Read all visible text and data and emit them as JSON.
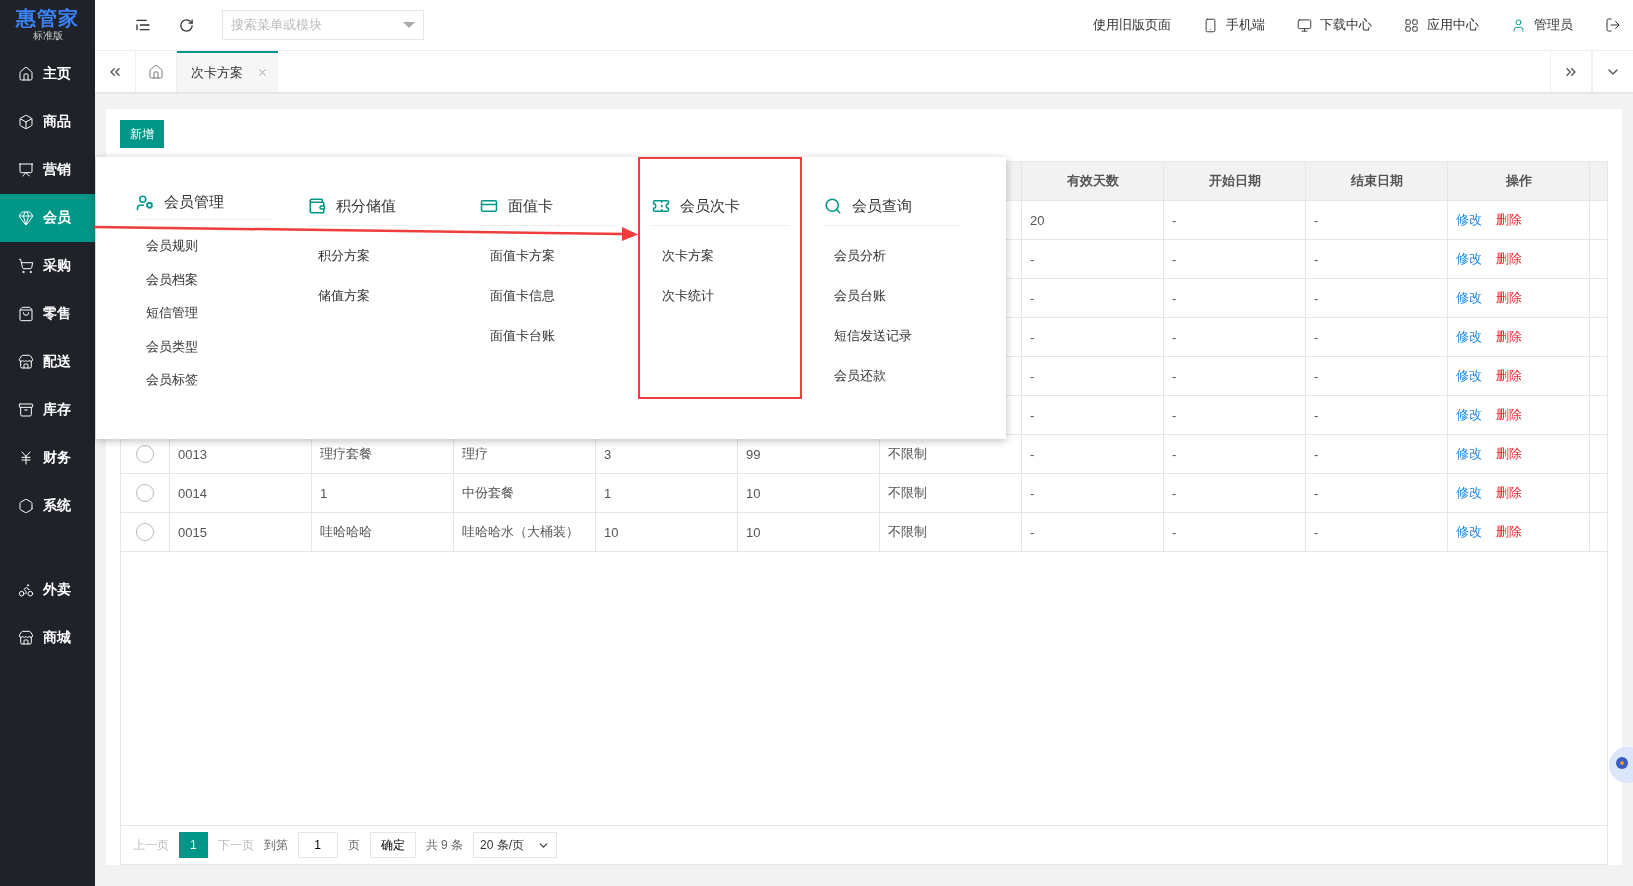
{
  "logo": {
    "name": "惠管家",
    "edition": "标准版"
  },
  "sidebar": {
    "groups": [
      [
        {
          "label": "主页",
          "selected": false
        },
        {
          "label": "商品",
          "selected": false
        },
        {
          "label": "营销",
          "selected": false
        },
        {
          "label": "会员",
          "selected": true
        },
        {
          "label": "采购",
          "selected": false
        },
        {
          "label": "零售",
          "selected": false
        },
        {
          "label": "配送",
          "selected": false
        },
        {
          "label": "库存",
          "selected": false
        },
        {
          "label": "财务",
          "selected": false
        },
        {
          "label": "系统",
          "selected": false
        }
      ],
      [
        {
          "label": "外卖",
          "selected": false
        },
        {
          "label": "商城",
          "selected": false
        }
      ]
    ]
  },
  "topbar": {
    "search": {
      "placeholder": "搜索菜单或模块"
    },
    "links": [
      {
        "label": "使用旧版页面"
      },
      {
        "label": "手机端"
      },
      {
        "label": "下载中心"
      },
      {
        "label": "应用中心"
      },
      {
        "label": "管理员"
      }
    ]
  },
  "tabs": [
    {
      "label": "次卡方案",
      "selected": true
    }
  ],
  "toolbar": {
    "add_button": "新增"
  },
  "menu": {
    "columns": [
      {
        "title": "会员管理",
        "highlighted": false,
        "items": [
          "会员规则",
          "会员档案",
          "短信管理",
          "会员类型",
          "会员标签"
        ]
      },
      {
        "title": "积分储值",
        "highlighted": false,
        "items": [
          "积分方案",
          "储值方案"
        ]
      },
      {
        "title": "面值卡",
        "highlighted": false,
        "items": [
          "面值卡方案",
          "面值卡信息",
          "面值卡台账"
        ]
      },
      {
        "title": "会员次卡",
        "highlighted": true,
        "items": [
          "次卡方案",
          "次卡统计"
        ]
      },
      {
        "title": "会员查询",
        "highlighted": false,
        "items": [
          "会员分析",
          "会员台账",
          "短信发送记录",
          "会员还款"
        ]
      }
    ]
  },
  "table": {
    "columns": [
      {
        "label": "有效天数"
      },
      {
        "label": "开始日期"
      },
      {
        "label": "结束日期"
      },
      {
        "label": "操作"
      }
    ],
    "rows": [
      {
        "tail": [
          "20",
          "-",
          "-"
        ],
        "actions": [
          "修改",
          "删除"
        ]
      },
      {
        "tail": [
          "-",
          "-",
          "-"
        ],
        "actions": [
          "修改",
          "删除"
        ]
      },
      {
        "tail": [
          "-",
          "-",
          "-"
        ],
        "actions": [
          "修改",
          "删除"
        ]
      },
      {
        "tail": [
          "-",
          "-",
          "-"
        ],
        "actions": [
          "修改",
          "删除"
        ]
      },
      {
        "tail": [
          "-",
          "-",
          "-"
        ],
        "actions": [
          "修改",
          "删除"
        ]
      },
      {
        "tail": [
          "-",
          "-",
          "-"
        ],
        "actions": [
          "修改",
          "删除"
        ]
      },
      {
        "selected": false,
        "lead": [
          "0013",
          "理疗套餐",
          "理疗",
          "3",
          "99",
          "不限制"
        ],
        "tail": [
          "-",
          "-",
          "-"
        ],
        "actions": [
          "修改",
          "删除"
        ]
      },
      {
        "selected": false,
        "lead": [
          "0014",
          "1",
          "中份套餐",
          "1",
          "10",
          "不限制"
        ],
        "tail": [
          "-",
          "-",
          "-"
        ],
        "actions": [
          "修改",
          "删除"
        ]
      },
      {
        "selected": false,
        "lead": [
          "0015",
          "哇哈哈哈",
          "哇哈哈水（大桶装）",
          "10",
          "10",
          "不限制"
        ],
        "tail": [
          "-",
          "-",
          "-"
        ],
        "actions": [
          "修改",
          "删除"
        ]
      }
    ]
  },
  "pagination": {
    "prev": {
      "label": "上一页",
      "disabled": true
    },
    "pages": [
      {
        "label": "1",
        "selected": true
      }
    ],
    "next": {
      "label": "下一页",
      "disabled": true
    },
    "goto": "到第",
    "page_value": "1",
    "page_unit": "页",
    "confirm": "确定",
    "total": "共 9 条",
    "page_size": "20 条/页"
  }
}
